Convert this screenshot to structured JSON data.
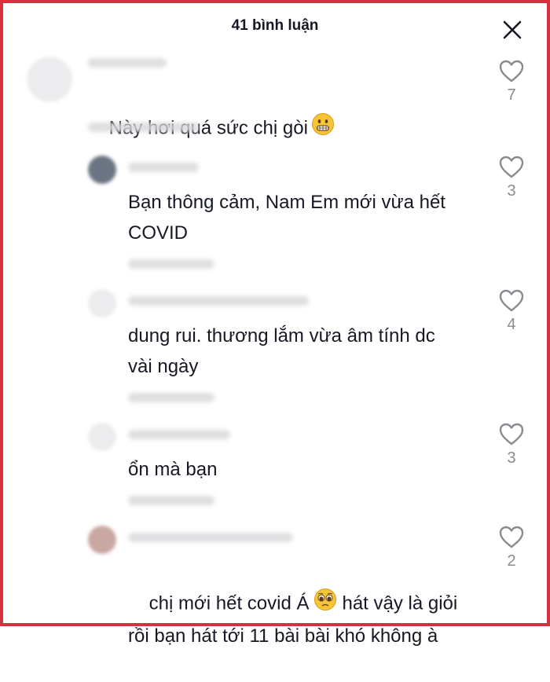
{
  "header": {
    "title": "41 bình luận"
  },
  "comments": [
    {
      "text": "Này hơi quá sức chị gòi",
      "emoji": "grimace-emoji",
      "likes": "7"
    },
    {
      "text": "Bạn thông cảm, Nam Em mới vừa hết\nCOVID",
      "likes": "3"
    },
    {
      "text": "dung rui. thương lắm vừa âm tính dc\nvài ngày",
      "likes": "4"
    },
    {
      "text": "ổn mà bạn",
      "likes": "3"
    },
    {
      "text": "chị mới hết covid Á",
      "text_after": "hát vậy là giỏi\nrồi bạn hát tới 11 bài bài khó không à",
      "emoji": "pleading-emoji",
      "likes": "2"
    }
  ],
  "icons": {
    "close": "close-icon",
    "like": "heart-outline-icon"
  },
  "colors": {
    "frame": "#d7303e",
    "text": "#161823",
    "muted": "#8a8b91"
  }
}
